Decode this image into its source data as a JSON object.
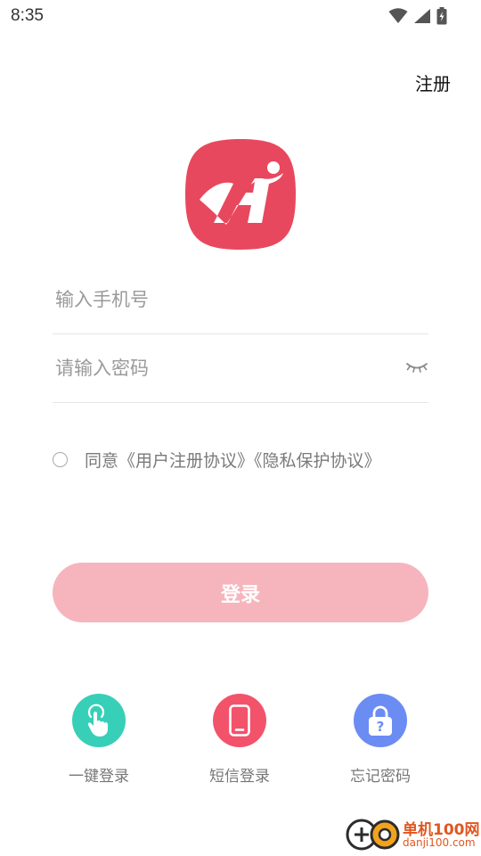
{
  "status_bar": {
    "time": "8:35",
    "icons": [
      "wifi-icon",
      "signal-icon",
      "battery-charging-icon"
    ]
  },
  "header": {
    "register_label": "注册"
  },
  "logo": {
    "icon": "app-logo-icon",
    "color": "#e8485e"
  },
  "form": {
    "phone_placeholder": "输入手机号",
    "phone_value": "",
    "password_placeholder": "请输入密码",
    "password_value": "",
    "password_toggle_icon": "eye-closed-icon"
  },
  "agreement": {
    "checked": false,
    "text": "同意《用户注册协议》《隐私保护协议》"
  },
  "login_button": {
    "label": "登录",
    "color": "#f6b5bd"
  },
  "quick_actions": [
    {
      "label": "一键登录",
      "icon": "tap-hand-icon",
      "color": "#37cfb8"
    },
    {
      "label": "短信登录",
      "icon": "phone-icon",
      "color": "#f2536a"
    },
    {
      "label": "忘记密码",
      "icon": "lock-question-icon",
      "color": "#6b8cf2"
    }
  ],
  "watermark": {
    "line1": "单机100网",
    "line2": "danji100.com"
  }
}
